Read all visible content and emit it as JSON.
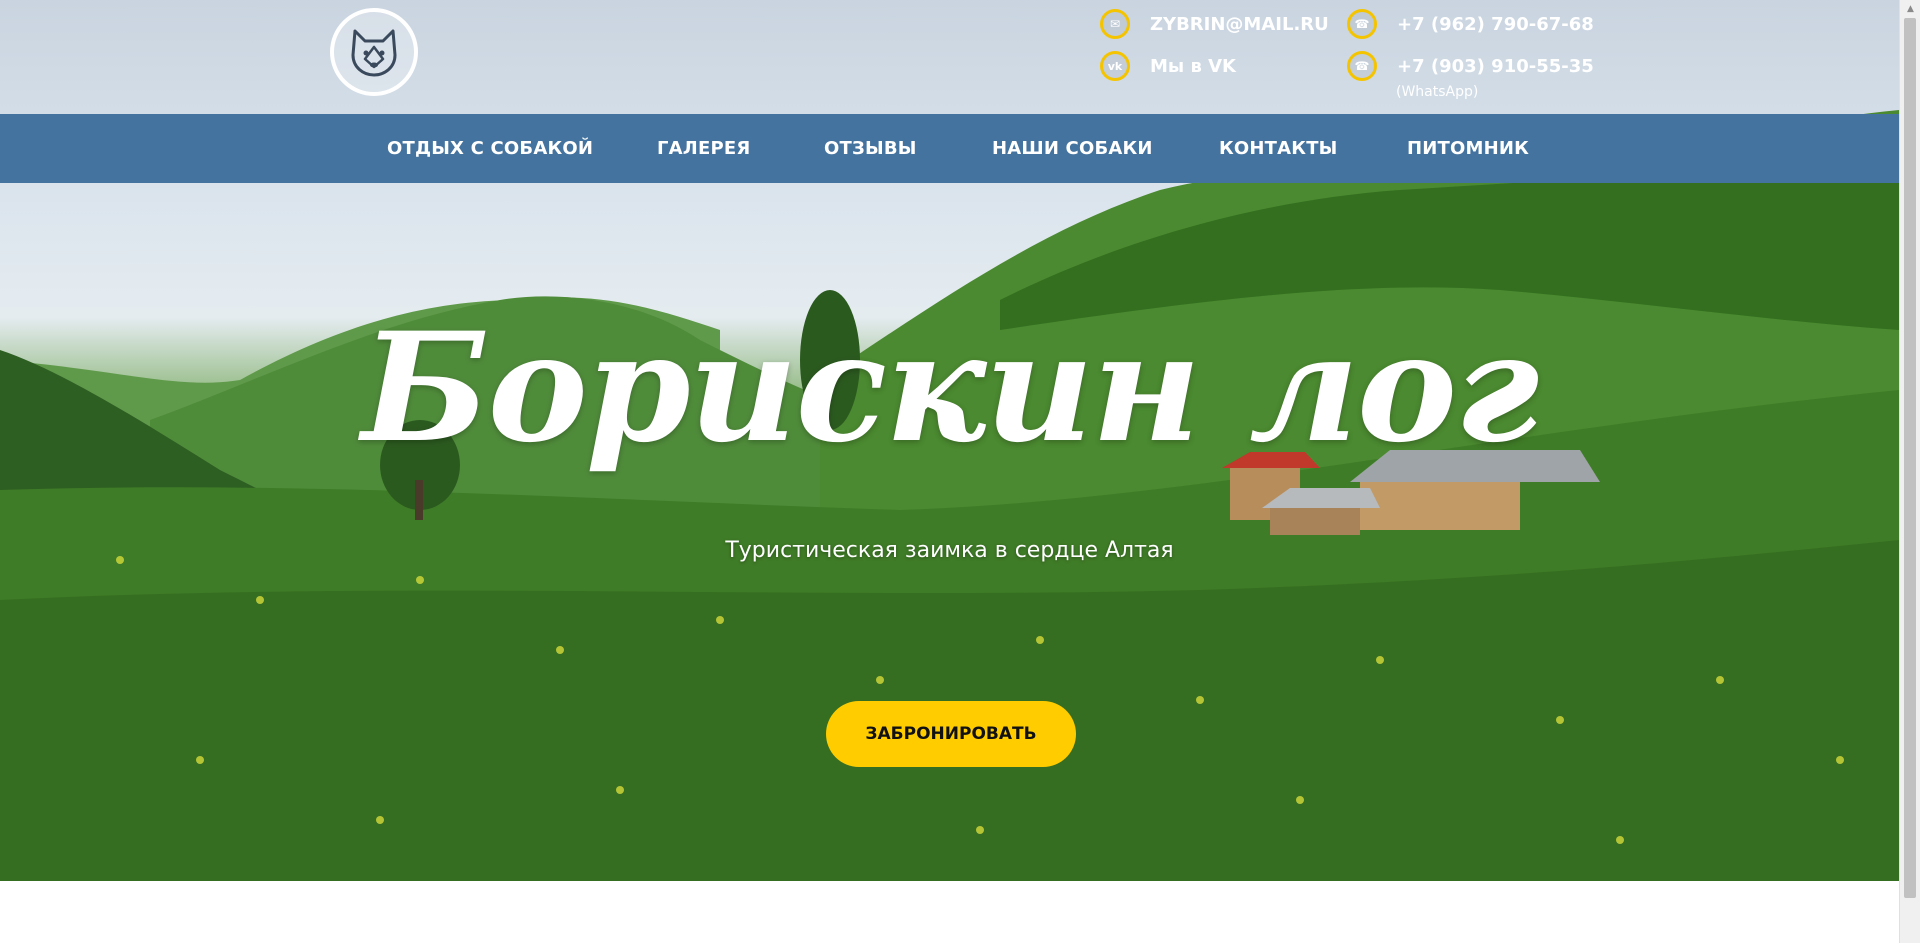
{
  "header": {
    "logo_icon": "husky-dog-icon",
    "email": "ZYBRIN@MAIL.RU",
    "vk": "Мы в VK",
    "phone1": "+7 (962) 790-67-68",
    "phone2": "+7 (903) 910-55-35",
    "phone2_note": "(WhatsApp)",
    "icon_ring_color": "#f5c400"
  },
  "nav": {
    "background": "#44739f",
    "items": [
      {
        "label": "ОТДЫХ С СОБАКОЙ"
      },
      {
        "label": "ГАЛЕРЕЯ"
      },
      {
        "label": "ОТЗЫВЫ"
      },
      {
        "label": "НАШИ СОБАКИ"
      },
      {
        "label": "КОНТАКТЫ"
      },
      {
        "label": "ПИТОМНИК"
      }
    ]
  },
  "hero": {
    "title": "Борискин лог",
    "subtitle": "Туристическая заимка в сердце Алтая",
    "book_button": "ЗАБРОНИРОВАТЬ",
    "button_color": "#ffcc00"
  }
}
